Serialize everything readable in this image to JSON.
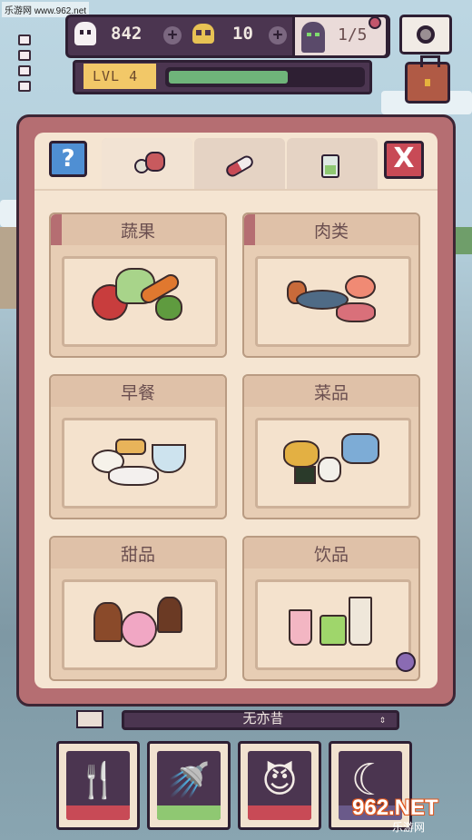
{
  "watermark": {
    "top_text": "乐游网 www.962.net",
    "logo_text": "962.NET",
    "logo_sub": "乐游网"
  },
  "hud": {
    "ghost_count": "842",
    "skull_count": "10",
    "monsters": "1/5",
    "level_label": "LVL 4",
    "xp_progress": 0.62
  },
  "panel": {
    "help_glyph": "?",
    "close_glyph": "X",
    "tabs": [
      {
        "name": "food",
        "icon": "radish-meat-icon",
        "active": true
      },
      {
        "name": "medicine",
        "icon": "pill-icon",
        "active": false
      },
      {
        "name": "drink-jar",
        "icon": "jar-icon",
        "active": false
      }
    ],
    "categories": [
      {
        "label": "蔬果",
        "icon": "vegetables-icon",
        "flagged": true
      },
      {
        "label": "肉类",
        "icon": "meat-icon",
        "flagged": true
      },
      {
        "label": "早餐",
        "icon": "breakfast-icon",
        "flagged": false
      },
      {
        "label": "菜品",
        "icon": "dishes-icon",
        "flagged": false
      },
      {
        "label": "甜品",
        "icon": "desserts-icon",
        "flagged": false
      },
      {
        "label": "饮品",
        "icon": "drinks-icon",
        "flagged": false
      }
    ]
  },
  "bottom": {
    "name_text": "无亦昔",
    "arrow": "⇕",
    "actions": [
      {
        "name": "feed",
        "icon": "fork-knife-icon",
        "glyph": "🍴",
        "wave": "#c84a56"
      },
      {
        "name": "bath",
        "icon": "shower-icon",
        "glyph": "🚿",
        "wave": "#8fc872"
      },
      {
        "name": "play",
        "icon": "devil-face-icon",
        "glyph": "😈",
        "wave": "#c84a56"
      },
      {
        "name": "sleep",
        "icon": "moon-icon",
        "glyph": "☾",
        "wave": "#6a5a8a"
      }
    ]
  },
  "colors": {
    "accent": "#b56e72",
    "panel": "#f5e5d2",
    "hud": "#4b3550",
    "xp": "#6fb47a"
  }
}
